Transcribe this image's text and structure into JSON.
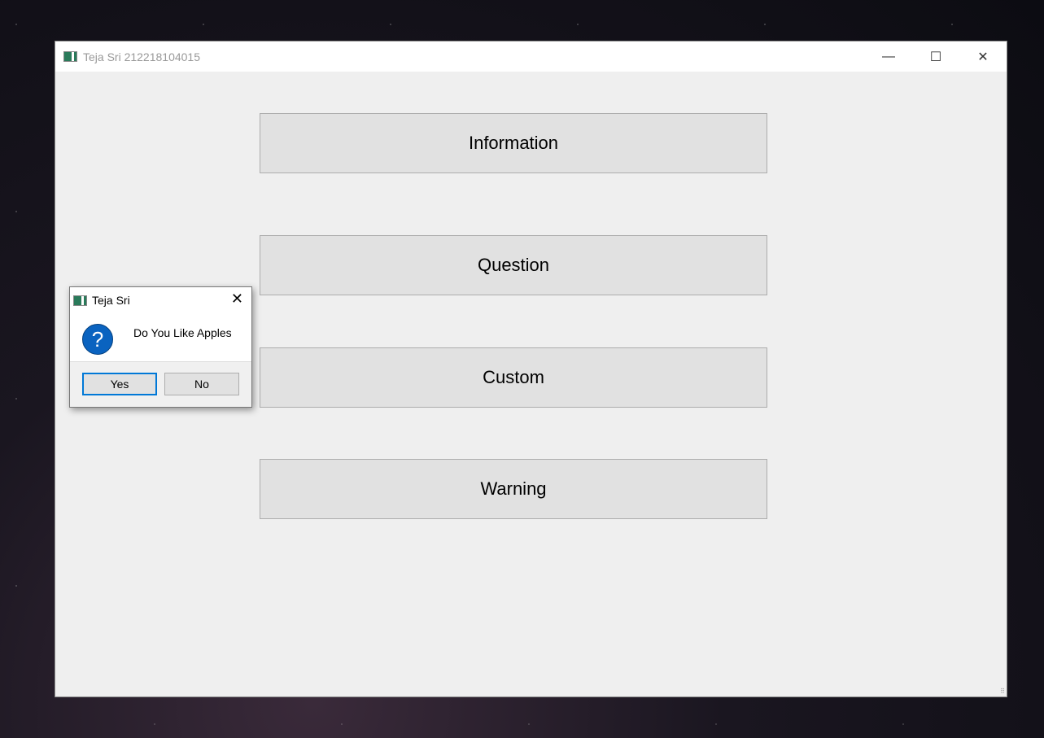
{
  "window": {
    "title": "Teja Sri 212218104015",
    "minimize": "—",
    "maximize": "☐",
    "close": "✕"
  },
  "buttons": [
    "Information",
    "Question",
    "Custom",
    "Warning"
  ],
  "dialog": {
    "title": "Teja Sri",
    "close": "✕",
    "icon": "?",
    "message": "Do You Like Apples",
    "yes": "Yes",
    "no": "No"
  }
}
